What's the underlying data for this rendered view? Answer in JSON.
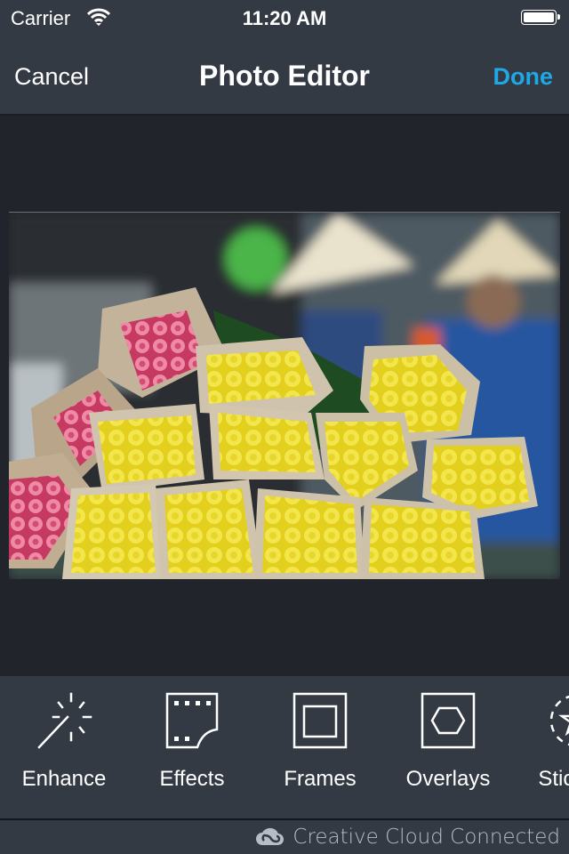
{
  "status_bar": {
    "carrier": "Carrier",
    "time": "11:20 AM",
    "wifi_icon": "wifi-icon",
    "battery_icon": "battery-icon",
    "battery_level": 1.0
  },
  "nav": {
    "cancel_label": "Cancel",
    "title": "Photo Editor",
    "done_label": "Done"
  },
  "colors": {
    "accent": "#1fa8e6",
    "bar_bg": "#343a44",
    "canvas_bg": "#21242b"
  },
  "photo": {
    "description": "Bundles of yellow and pink roses wrapped in paper at a market, vendors in conical hats in background",
    "icon": "photo-image"
  },
  "toolbar": {
    "tools": [
      {
        "label": "Enhance",
        "icon": "magic-wand-icon"
      },
      {
        "label": "Effects",
        "icon": "film-effects-icon"
      },
      {
        "label": "Frames",
        "icon": "frame-icon"
      },
      {
        "label": "Overlays",
        "icon": "hexagon-overlay-icon"
      },
      {
        "label": "Stickers",
        "icon": "sticker-star-icon"
      }
    ]
  },
  "footer": {
    "label": "Creative Cloud Connected",
    "icon": "creative-cloud-icon"
  }
}
